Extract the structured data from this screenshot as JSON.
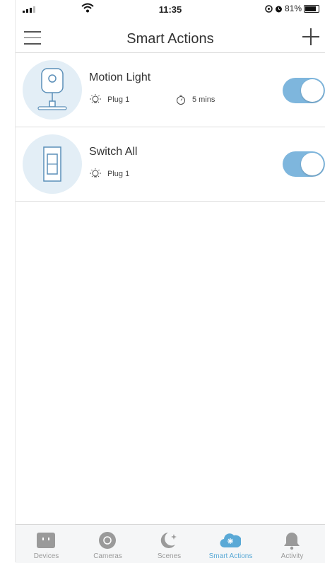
{
  "status_bar": {
    "time": "11:35",
    "battery_percent": "81%"
  },
  "header": {
    "title": "Smart Actions"
  },
  "actions": [
    {
      "title": "Motion Light",
      "trigger": "Plug 1",
      "duration": "5 mins",
      "enabled": true
    },
    {
      "title": "Switch All",
      "trigger": "Plug 1",
      "enabled": true
    }
  ],
  "tabs": [
    {
      "label": "Devices"
    },
    {
      "label": "Cameras"
    },
    {
      "label": "Scenes"
    },
    {
      "label": "Smart Actions"
    },
    {
      "label": "Activity"
    }
  ],
  "colors": {
    "accent": "#5aa9d6",
    "toggle_on": "#7eb6dd",
    "icon_bg": "#e3eef6",
    "tab_inactive": "#9a9a9a"
  }
}
